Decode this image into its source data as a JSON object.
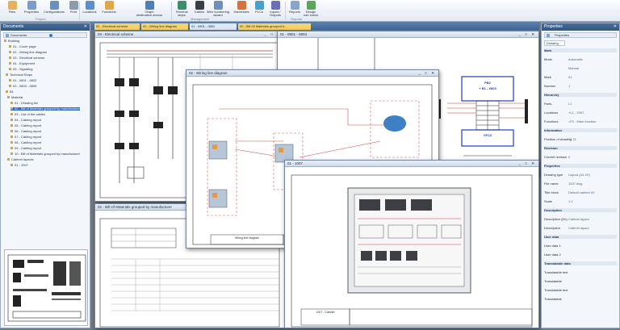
{
  "ribbon": {
    "buttons": [
      {
        "label": "Files"
      },
      {
        "label": "Properties"
      },
      {
        "label": "Configurations"
      },
      {
        "label": "Print"
      },
      {
        "label": "Locations"
      },
      {
        "label": "Functions"
      },
      {
        "label": "Graph\ndestination arrows"
      },
      {
        "label": "Terminal\nstrips"
      },
      {
        "label": "Cables"
      },
      {
        "label": "Wire numbering\nwizard"
      },
      {
        "label": "Harnesses"
      },
      {
        "label": "PLCs"
      },
      {
        "label": "Inputs /\nOutputs"
      },
      {
        "label": "Reports"
      },
      {
        "label": "Design\nrule check"
      }
    ],
    "groups": [
      "Project",
      "Management",
      "Reports"
    ]
  },
  "documents": {
    "title": "Documents",
    "items": [
      "Building",
      "01 - Cover page",
      "02 - Wiring line diagram",
      "03 - Electrical scheme",
      "04 - Equipment",
      "05 - Signaling",
      "Technical Strips",
      "01 - 0801 - 0802",
      "02 - 0803 - 0805",
      "B1",
      "Material",
      "01 - Drawing list",
      "02 - Bill of Materials grouped by manufacturer",
      "03 - List of the cables",
      "04 - Cabling report",
      "05 - Cabling report",
      "06 - Cabling report",
      "07 - Cabling report",
      "08 - Cabling report",
      "09 - Cabling report",
      "10 - Bill of Materials grouped by manufacturer",
      "Cabinet layouts",
      "01 - 1007"
    ]
  },
  "tabs": [
    "01 - Electrical scheme",
    "02 - Wiring line diagram",
    "01 - 0801 - 0802",
    "02 - Bill Of Materials grouped b..."
  ],
  "windows": {
    "elec": "03 - Electrical scheme",
    "wiring": "02 - Wiring line diagram",
    "terminal": "01 - 0801 - 0803",
    "bom": "02 - Bill Of Materials grouped by manufacturer",
    "cabinet": "01 - 1007"
  },
  "terminal_block": {
    "header_line1": "PB2",
    "header_line2": "+ B1 - X803",
    "bottom_label": "VFC2"
  },
  "properties": {
    "title": "Properties",
    "tab": "Drawing",
    "rows": [
      {
        "k": "Mark",
        "v": "",
        "h": 1
      },
      {
        "k": "Mode",
        "v": "Automatic",
        "h": 0
      },
      {
        "k": "",
        "v": "Manual",
        "h": 0
      },
      {
        "k": "Mark",
        "v": "01",
        "h": 0
      },
      {
        "k": "Number",
        "v": "1",
        "h": 0
      },
      {
        "k": "Hierarchy",
        "v": "",
        "h": 1
      },
      {
        "k": "Parts",
        "v": "L1",
        "h": 0
      },
      {
        "k": "Locations",
        "v": "+L1 - 1007",
        "h": 0
      },
      {
        "k": "Functions",
        "v": "=F1 - Main function",
        "h": 0
      },
      {
        "k": "Information",
        "v": "",
        "h": 1
      },
      {
        "k": "Position of drawing",
        "v": "1 / 21",
        "h": 0
      },
      {
        "k": "Revision",
        "v": "",
        "h": 1
      },
      {
        "k": "Current revision",
        "v": "0",
        "h": 0
      },
      {
        "k": "Properties",
        "v": "",
        "h": 1
      },
      {
        "k": "Drawing type",
        "v": "Layout (A3 4V)",
        "h": 0
      },
      {
        "k": "File name",
        "v": "1007.dwg",
        "h": 0
      },
      {
        "k": "Title block",
        "v": "Default cabinet 4V",
        "h": 0
      },
      {
        "k": "Scale",
        "v": "1:1",
        "h": 0
      },
      {
        "k": "Description",
        "v": "",
        "h": 1
      },
      {
        "k": "Description (En)",
        "v": "Cabinet layout",
        "h": 0
      },
      {
        "k": "Description",
        "v": "Cabinet layout",
        "h": 0
      },
      {
        "k": "User data",
        "v": "",
        "h": 1
      },
      {
        "k": "User data 1",
        "v": "",
        "h": 0
      },
      {
        "k": "User data 2",
        "v": "",
        "h": 0
      },
      {
        "k": "Translatable data",
        "v": "",
        "h": 1
      },
      {
        "k": "Translatable text",
        "v": "",
        "h": 0
      },
      {
        "k": "Translatable",
        "v": "",
        "h": 0
      },
      {
        "k": "Translatable text",
        "v": "",
        "h": 0
      },
      {
        "k": "Translatable",
        "v": "",
        "h": 0
      }
    ]
  },
  "title_blocks": {
    "wiring": "Wiring line diagram",
    "cabinet": "1007 - Cabinet"
  }
}
